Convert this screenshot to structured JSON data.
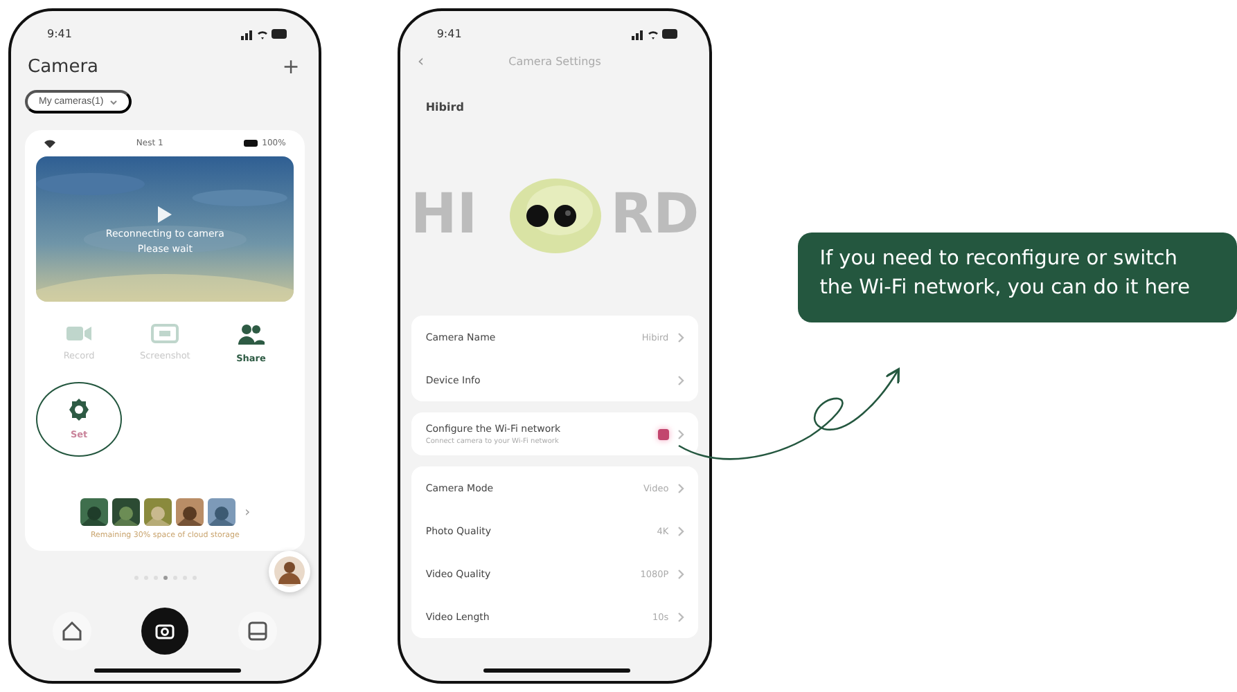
{
  "home_phone": {
    "status_time": "9:41",
    "title": "Camera",
    "add_button": "+",
    "camera_picker": "My cameras(1)",
    "device_bar": {
      "name": "Nest 1",
      "battery": "100%"
    },
    "preview": {
      "message_line1": "Reconnecting to camera",
      "message_line2": "Please wait"
    },
    "actions": [
      {
        "kind": "record",
        "label": "Record",
        "disabled": true
      },
      {
        "kind": "screenshot",
        "label": "Screenshot",
        "disabled": true
      },
      {
        "kind": "share",
        "label": "Share",
        "disabled": false
      },
      {
        "kind": "settings",
        "label": "Set",
        "disabled": false
      }
    ],
    "gallery_more": "›",
    "storage_note": "Remaining 30% space of cloud storage",
    "page_dots": [
      {
        "selected": false
      },
      {
        "selected": false
      },
      {
        "selected": false
      },
      {
        "selected": true
      },
      {
        "selected": false
      },
      {
        "selected": false
      },
      {
        "selected": false
      }
    ],
    "bottom_nav": [
      {
        "kind": "home",
        "selected": false
      },
      {
        "kind": "camera",
        "selected": true
      },
      {
        "kind": "gallery",
        "selected": false
      }
    ]
  },
  "settings_phone": {
    "status_time": "9:41",
    "back": "‹",
    "title": "Camera Settings",
    "device_label": "Hibird",
    "hero_left": "HI",
    "hero_right": "RD",
    "groups": [
      [
        {
          "label": "Camera Name",
          "value": "Hibird",
          "badge": false
        },
        {
          "label": "Device Info",
          "badge": false
        }
      ],
      [
        {
          "label": "Configure the Wi-Fi network",
          "subtitle": "Connect camera to your Wi-Fi network",
          "badge": true
        }
      ],
      [
        {
          "label": "Camera Mode",
          "value": "Video",
          "badge": false
        },
        {
          "label": "Photo Quality",
          "value": "4K",
          "badge": false
        },
        {
          "label": "Video Quality",
          "value": "1080P",
          "badge": false
        },
        {
          "label": "Video Length",
          "value": "10s",
          "badge": false
        }
      ]
    ]
  },
  "callout": {
    "text": "If you need to reconfigure or switch the Wi-Fi network, you can do it here"
  }
}
